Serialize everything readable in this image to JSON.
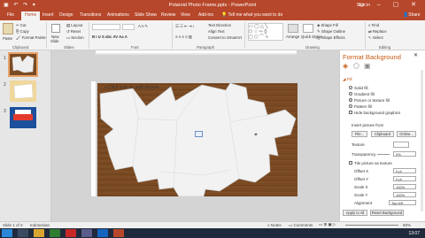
{
  "window": {
    "title": "Polaroid Photo Frame.pptx - PowerPoint",
    "sign_in": "Sign in"
  },
  "tabs": [
    "File",
    "Home",
    "Insert",
    "Design",
    "Transitions",
    "Animations",
    "Slide Show",
    "Review",
    "View",
    "Add-ins",
    "Tell me what you want to do"
  ],
  "share": "Share",
  "ribbon": {
    "clipboard": {
      "paste": "Paste",
      "cut": "Cut",
      "copy": "Copy",
      "format_painter": "Format Painter",
      "label": "Clipboard"
    },
    "slides": {
      "new_slide": "New",
      "new_slide_sub": "Slide",
      "layout": "Layout",
      "reset": "Reset",
      "section": "Section",
      "label": "Slides"
    },
    "font": {
      "label": "Font"
    },
    "paragraph": {
      "text_direction": "Text Direction",
      "align_text": "Align Text",
      "convert_smartart": "Convert to SmartArt",
      "label": "Paragraph"
    },
    "drawing": {
      "arrange": "Arrange",
      "quick_styles": "Quick Styles",
      "shape_fill": "Shape Fill",
      "shape_outline": "Shape Outline",
      "shape_effects": "Shape Effects",
      "label": "Drawing"
    },
    "editing": {
      "find": "Find",
      "replace": "Replace",
      "select": "Select",
      "label": "Editing"
    }
  },
  "slides": [
    {
      "number": "1"
    },
    {
      "number": "2"
    },
    {
      "number": "3"
    }
  ],
  "slide": {
    "placeholder": "Click icon to add picture"
  },
  "pane": {
    "title": "Format Background",
    "fill_section": "Fill",
    "options": [
      "Solid fill",
      "Gradient fill",
      "Picture or texture fill",
      "Pattern fill"
    ],
    "hide_graphics": "Hide background graphics",
    "insert_picture_from": "Insert picture from",
    "file_btn": "File...",
    "clipboard_btn": "Clipboard",
    "online_btn": "Online...",
    "texture": "Texture",
    "transparency": "Transparency",
    "transparency_value": "0%",
    "tile": "Tile picture as texture",
    "offset_x": "Offset X",
    "offset_x_value": "0 pt",
    "offset_y": "Offset Y",
    "offset_y_value": "0 pt",
    "scale_x": "Scale X",
    "scale_x_value": "100%",
    "scale_y": "Scale Y",
    "scale_y_value": "100%",
    "alignment": "Alignment",
    "alignment_value": "Top left",
    "apply_all": "Apply to All",
    "reset_bg": "Reset Background"
  },
  "status": {
    "slide_of": "Slide 1 of 3",
    "language": "Indonesian",
    "notes": "Notes",
    "comments": "Comments",
    "zoom": "50%"
  },
  "taskbar": {
    "time": "13:07"
  },
  "colors": {
    "accent": "#b7472a",
    "pane_title": "#c55a11",
    "wood": "#7a4a22"
  }
}
